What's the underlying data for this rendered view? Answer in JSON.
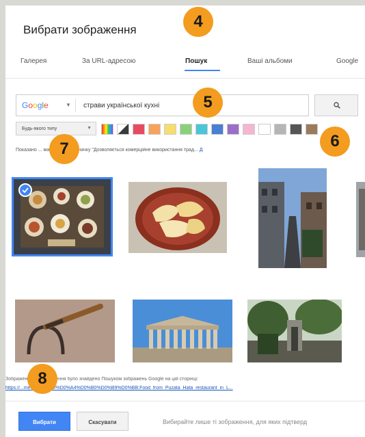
{
  "dialog": {
    "title": "Вибрати зображення"
  },
  "tabs": [
    {
      "label": "Галерея"
    },
    {
      "label": "За URL-адресою"
    },
    {
      "label": "Пошук"
    },
    {
      "label": "Ваші альбоми"
    },
    {
      "label": "Google"
    }
  ],
  "search": {
    "engine_logo": [
      "G",
      "o",
      "o",
      "g",
      "l",
      "e"
    ],
    "query": "страви української кухні",
    "button_icon": "search-icon"
  },
  "filters": {
    "type_label": "Будь-якого типу",
    "colors": [
      "multicolor",
      "#3a3a3a",
      "#e84a5f",
      "#f7a35c",
      "#f7dc6f",
      "#8bd17c",
      "#4ac6d8",
      "#4a7fd4",
      "#9b6fc7",
      "#f4b6d0",
      "#ffffff",
      "#b5b5b5",
      "#555555",
      "#9a7b5c"
    ]
  },
  "notice": {
    "text": "Показано ... мати мають позначку \"Дозволяється комерційне використання трад...",
    "link": "Д"
  },
  "source": {
    "text": "Зображення ... зображення було знайдено Пошуком зображень Google на цій сторінці:",
    "link": "https://...media.org/wiki/%D0%A4%D0%B0%D0%B9%D0%BB:Food_from_Puzata_Hata_restaurant_in_L..."
  },
  "footer": {
    "select_label": "Вибрати",
    "cancel_label": "Скасувати",
    "note": "Вибирайте лише ті зображення, для яких підтверд"
  },
  "markers": [
    "4",
    "5",
    "6",
    "7",
    "8"
  ]
}
